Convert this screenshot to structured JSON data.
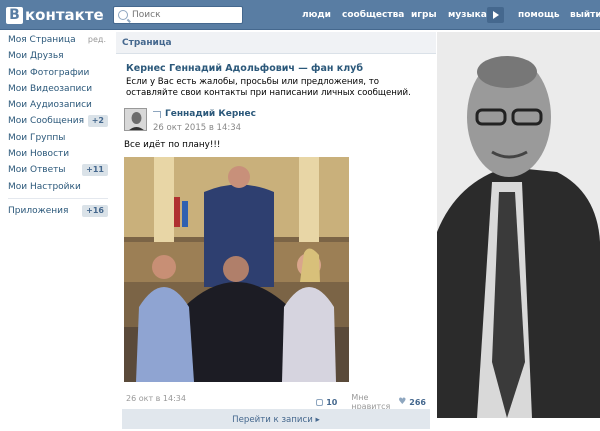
{
  "header": {
    "logo_letter": "В",
    "logo_text": "контакте",
    "search_placeholder": "Поиск",
    "nav": [
      "люди",
      "сообщества",
      "игры",
      "музыка",
      "помощь",
      "выйти"
    ]
  },
  "menu": {
    "items": [
      {
        "label": "Моя Страница",
        "extra": "ред."
      },
      {
        "label": "Мои Друзья"
      },
      {
        "label": "Мои Фотографии"
      },
      {
        "label": "Мои Видеозаписи"
      },
      {
        "label": "Мои Аудиозаписи"
      },
      {
        "label": "Мои Сообщения",
        "count": "+2"
      },
      {
        "label": "Мои Группы"
      },
      {
        "label": "Мои Новости"
      },
      {
        "label": "Мои Ответы",
        "count": "+11"
      },
      {
        "label": "Мои Настройки"
      }
    ],
    "apps": {
      "label": "Приложения",
      "count": "+16"
    }
  },
  "main": {
    "breadcrumb": "Страница",
    "group_title": "Кернес Геннадий Адольфович — фан клуб",
    "group_description": "Если у Вас есть жалобы, просьбы или предложения, то оставляйте свои контакты при написании личных сообщений.",
    "post": {
      "author": "Геннадий Кернес",
      "date": "26 окт 2015 в 14:34",
      "text": "Все идёт по плану!!!",
      "footer_date": "26 окт в 14:34",
      "comments": "10",
      "like_label": "Мне нравится",
      "likes": "266",
      "goto_label": "Перейти к записи ▸"
    }
  },
  "colors": {
    "header": "#597da3",
    "link": "#2b587a",
    "counter_bg": "#dae2e8"
  },
  "icons": [
    "search-icon",
    "play-icon",
    "share-icon",
    "comment-icon",
    "heart-icon"
  ]
}
